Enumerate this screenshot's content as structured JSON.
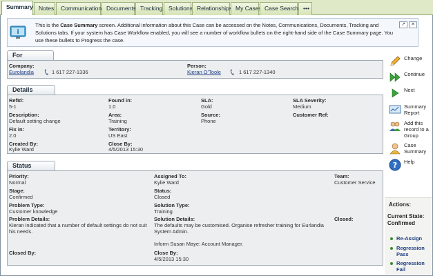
{
  "tabs": [
    {
      "label": "Summary",
      "active": true
    },
    {
      "label": "Notes"
    },
    {
      "label": "Communications"
    },
    {
      "label": "Documents"
    },
    {
      "label": "Tracking"
    },
    {
      "label": "Solutions"
    },
    {
      "label": "Relationships"
    },
    {
      "label": "My Cases"
    },
    {
      "label": "Case Search"
    },
    {
      "label": "•••"
    }
  ],
  "info": {
    "text_before": "This is the ",
    "text_bold": "Case Summary",
    "text_after": " screen. Additional information about this Case can be accessed on the Notes, Communications, Documents, Tracking and Solutions tabs. If your system has Case Workflow enabled, you will see a number of workflow bullets on the right-hand side of the Case Summary page. You use these bullets to Progress the case.",
    "btn1": "↗",
    "btn2": "✕"
  },
  "for": {
    "title": "For",
    "company_label": "Company:",
    "company": "Eurolandia",
    "company_phone": "1 617 227-1336",
    "person_label": "Person:",
    "person": "Kieran O'Toole",
    "person_phone": "1 617 227-1340"
  },
  "details": {
    "title": "Details",
    "refid_label": "RefId:",
    "refid": "5-1",
    "found_label": "Found in:",
    "found": "1.0",
    "sla_label": "SLA:",
    "sla": "Gold",
    "severity_label": "SLA Severity:",
    "severity": "Medium",
    "desc_label": "Description:",
    "desc": "Default setting change",
    "area_label": "Area:",
    "area": "Training",
    "source_label": "Source:",
    "source": "Phone",
    "custref_label": "Customer Ref:",
    "fixin_label": "Fix in:",
    "fixin": "2.0",
    "territory_label": "Territory:",
    "territory": "US East",
    "createdby_label": "Created By:",
    "createdby": "Kylie Ward",
    "closeby_label": "Close By:",
    "closeby": "4/5/2013 15:30"
  },
  "status": {
    "title": "Status",
    "priority_label": "Priority:",
    "priority": "Normal",
    "assigned_label": "Assigned To:",
    "assigned": "Kylie Ward",
    "team_label": "Team:",
    "team": "Customer Service",
    "stage_label": "Stage:",
    "stage": "Confirmed",
    "status_label": "Status:",
    "status": "Closed",
    "ptype_label": "Problem Type:",
    "ptype": "Customer knowledge",
    "stype_label": "Solution Type:",
    "stype": "Training",
    "pdetails_label": "Problem Details:",
    "pdetails": "Kieran indicated that a number of default settings do not suit his needs.",
    "sdetails_label": "Solution Details:",
    "sdetails": "The defaults may be customised.  Organise refresher training for Eurlandia System Admin.",
    "sdetails2": "Inform Susan Maye: Account Manager.",
    "closed_label": "Closed:",
    "closedby_label": "Closed By:",
    "closeby_label": "Close By:",
    "closeby": "4/5/2013 15:30"
  },
  "actions": [
    {
      "label": "Change",
      "icon": "pencil-icon"
    },
    {
      "label": "Continue",
      "icon": "fast-forward-icon"
    },
    {
      "label": "Next",
      "icon": "play-icon"
    },
    {
      "label": "Summary Report",
      "icon": "report-icon"
    },
    {
      "label": "Add this record to a Group",
      "icon": "group-icon"
    },
    {
      "label": "Case Summary",
      "icon": "user-icon"
    },
    {
      "label": "Help",
      "icon": "help-icon"
    }
  ],
  "workflow": {
    "title": "Actions:",
    "state_label": "Current State:",
    "state": "Confirmed",
    "items": [
      "Re-Assign",
      "Regression Pass",
      "Regression Fail"
    ]
  },
  "colors": {
    "accent": "#dfe9c8",
    "link": "#1f3f8a",
    "workflow_dot": "#3a8a2a"
  }
}
